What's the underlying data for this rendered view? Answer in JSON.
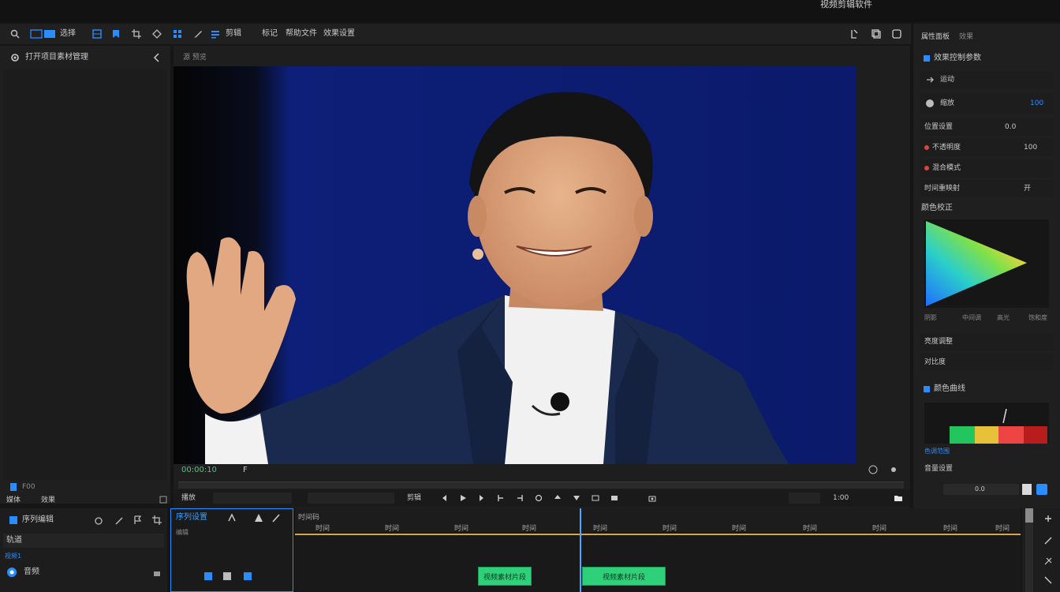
{
  "window": {
    "title": "视频剪辑软件"
  },
  "toolbar": {
    "items": [
      "选择",
      "剪辑",
      "标记",
      "帮助文件",
      "效果设置"
    ],
    "right_icons": [
      "export-icon",
      "copy-icon",
      "window-icon"
    ]
  },
  "left_panel": {
    "header": "打开项目素材管理",
    "bottom_left": "媒体",
    "bottom_right": "效果",
    "file_label": "F00"
  },
  "preview": {
    "header": "源 预览",
    "timecode": "00:00:10",
    "marker": "F"
  },
  "transport": {
    "left_label": "播放",
    "center_label": "剪辑",
    "zoom": "1:00"
  },
  "timeline_left": {
    "header": "序列编辑",
    "track_label": "轨道",
    "sub_label": "视频1",
    "row_label": "音频"
  },
  "timeline_header": {
    "header": "序列设置",
    "tool_label": "编辑",
    "ruler_labels": [
      "时间码",
      "时间",
      "时间",
      "时间",
      "时间",
      "时间",
      "时间",
      "时间",
      "时间",
      "时间",
      "时间",
      "时间"
    ],
    "clip_a": "视频素材片段",
    "clip_b": "视频素材片段"
  },
  "right_panel": {
    "tab_a": "属性面板",
    "tab_b": "效果",
    "section_title": "效果控制参数",
    "rows": [
      {
        "label": "运动",
        "value": ""
      },
      {
        "label": "缩放",
        "value": "100"
      },
      {
        "label": "位置设置",
        "value": "0.0"
      },
      {
        "label": "不透明度",
        "value": "100"
      },
      {
        "label": "混合模式",
        "value": ""
      },
      {
        "label": "时间重映射",
        "value": "开"
      }
    ],
    "color_title": "颜色校正",
    "color_labels": [
      "阴影",
      "中间调",
      "高光",
      "饱和度"
    ],
    "row_a": "亮度调整",
    "row_b": "对比度",
    "lut_title": "颜色曲线",
    "lut_label": "色调范围",
    "bottom_label": "音量设置",
    "slider_value": "0.0"
  },
  "colors": {
    "accent": "#2a8dff",
    "clip": "#2fd07a",
    "playhead": "#4aa6ff",
    "timeline_line": "#d6a64a"
  },
  "image": {
    "description_icon": "person-photo"
  }
}
